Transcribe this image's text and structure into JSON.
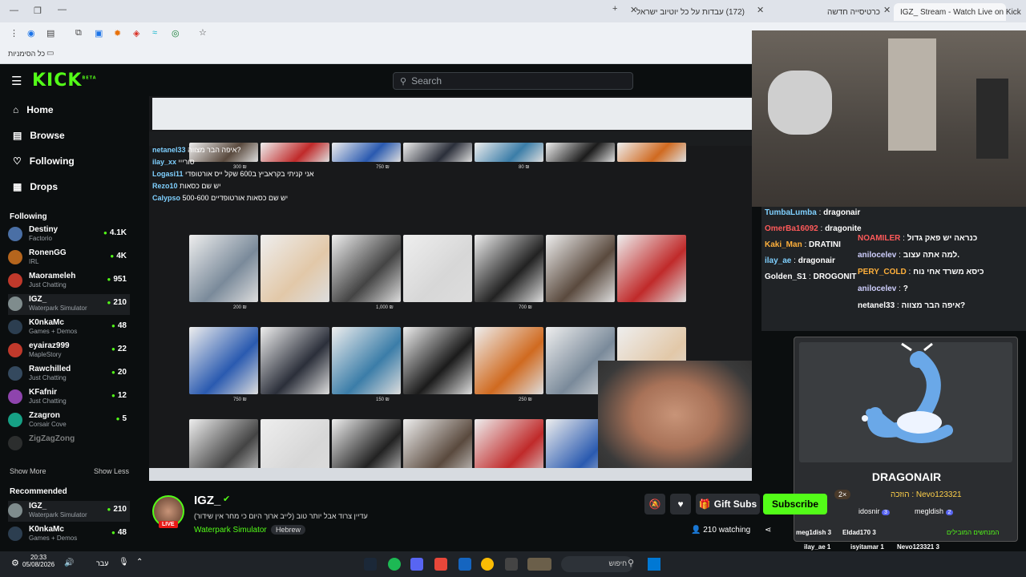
{
  "browser": {
    "tabs": [
      {
        "label": "כרטיסייה חדשה"
      },
      {
        "label": "(172) עבדות על כל יוטיוב ישראל"
      },
      {
        "label": "IGZ_ Stream - Watch Live on Kick",
        "active": true
      }
    ],
    "bookmarks_label": "כל הסימניות"
  },
  "kick": {
    "logo": "KICK",
    "logo_badge": "BETA",
    "search_placeholder": "Search",
    "nav": [
      {
        "label": "Home",
        "icon": "home-icon"
      },
      {
        "label": "Browse",
        "icon": "browse-icon"
      },
      {
        "label": "Following",
        "icon": "heart-icon"
      },
      {
        "label": "Drops",
        "icon": "drops-icon"
      }
    ],
    "following_title": "Following",
    "following": [
      {
        "name": "Destiny",
        "category": "Factorio",
        "viewers": "4.1K",
        "color": "#4a6fa5"
      },
      {
        "name": "RonenGG",
        "category": "IRL",
        "viewers": "4K",
        "color": "#b5651d"
      },
      {
        "name": "Maorameleh",
        "category": "Just Chatting",
        "viewers": "951",
        "color": "#c0392b"
      },
      {
        "name": "IGZ_",
        "category": "Waterpark Simulator",
        "viewers": "210",
        "color": "#7f8c8d",
        "active": true
      },
      {
        "name": "K0nkaMc",
        "category": "Games + Demos",
        "viewers": "48",
        "color": "#2c3e50"
      },
      {
        "name": "eyairaz999",
        "category": "MapleStory",
        "viewers": "22",
        "color": "#c0392b"
      },
      {
        "name": "Rawchilled",
        "category": "Just Chatting",
        "viewers": "20",
        "color": "#34495e"
      },
      {
        "name": "KFafnir",
        "category": "Just Chatting",
        "viewers": "12",
        "color": "#8e44ad"
      },
      {
        "name": "Zzagron",
        "category": "Corsair Cove",
        "viewers": "5",
        "color": "#16a085"
      },
      {
        "name": "ZigZagZong",
        "category": "",
        "viewers": "",
        "color": "#555555"
      }
    ],
    "show_more": "Show More",
    "show_less": "Show Less",
    "recommended_title": "Recommended",
    "recommended": [
      {
        "name": "IGZ_",
        "category": "Waterpark Simulator",
        "viewers": "210",
        "color": "#7f8c8d"
      },
      {
        "name": "K0nkaMc",
        "category": "Games + Demos",
        "viewers": "48",
        "color": "#2c3e50"
      }
    ]
  },
  "stream": {
    "overlay_chat": [
      {
        "user": "netanel33",
        "msg": "איפה הבר מצווה?"
      },
      {
        "user": "ilay_xx",
        "msg": "סורייי"
      },
      {
        "user": "Logasi11",
        "msg": "אני קניתי בקראביץ ב600 שקל ייס אורטופדי"
      },
      {
        "user": "Rezo10",
        "msg": "יש שם כסאות"
      },
      {
        "user": "Calypso",
        "msg": "יש שם כסאות אורטופדיים 500-600"
      }
    ],
    "prices": [
      "300 ₪",
      "750 ₪",
      "80 ₪",
      "200 ₪",
      "1,000 ₪",
      "700 ₪",
      "750 ₪",
      "150 ₪",
      "250 ₪"
    ],
    "cam_chat": [
      {
        "user": "TumbaLumba",
        "msg": "dragonair",
        "color": "#7fd0ff"
      },
      {
        "user": "OmerBa16092",
        "msg": "dragonite",
        "color": "#ff5a5a"
      },
      {
        "user": "Kaki_Man",
        "msg": "DRATINI",
        "color": "#ffb03b"
      },
      {
        "user": "ilay_ae",
        "msg": "dragonair",
        "color": "#7fd0ff"
      },
      {
        "user": "Golden_S1",
        "msg": "DROGONIT",
        "color": "#ffffff"
      },
      {
        "user": "NOAMILER",
        "msg": "כנראה יש פאק גדול",
        "color": "#ff5a5a"
      },
      {
        "user": "anilocelev",
        "msg": "למה אתה עצוב.",
        "color": "#d0d0ff"
      },
      {
        "user": "PERY_COLD",
        "msg": "כיסא משרד אחי נוח",
        "color": "#ffb03b"
      },
      {
        "user": "anilocelev",
        "msg": "?",
        "color": "#d0d0ff"
      },
      {
        "user": "netanel33",
        "msg": "איפה הבר מצווה?",
        "color": "#ffffff"
      }
    ],
    "pokemon_name": "DRAGONAIR",
    "points_line": "Nevo123321 : הוזכה",
    "multiplier": "2×",
    "winners_top": [
      "idosnir",
      "megldish"
    ],
    "winners_badges": [
      "3",
      "2"
    ],
    "winners_label": "המנחשים המובילים",
    "winners": [
      "meg1dish 3",
      "Eldad170 3",
      "ilay_ae 1",
      "isyitamar 1",
      "Nevo123321 3"
    ]
  },
  "channel": {
    "name": "IGZ_",
    "title": "עדיין צרוד אבל יותר טוב (לייב ארוך היום כי מחר אין שידור)",
    "category": "Waterpark Simulator",
    "language": "Hebrew",
    "live_badge": "LIVE",
    "watching": "210 watching",
    "gift_subs": "Gift Subs",
    "subscribe": "Subscribe"
  },
  "taskbar": {
    "time": "20:33",
    "date": "05/08/2026",
    "lang": "עבר",
    "search_label": "חיפוש"
  },
  "colors": {
    "accent": "#53fc18",
    "bg": "#0b0e0f"
  }
}
